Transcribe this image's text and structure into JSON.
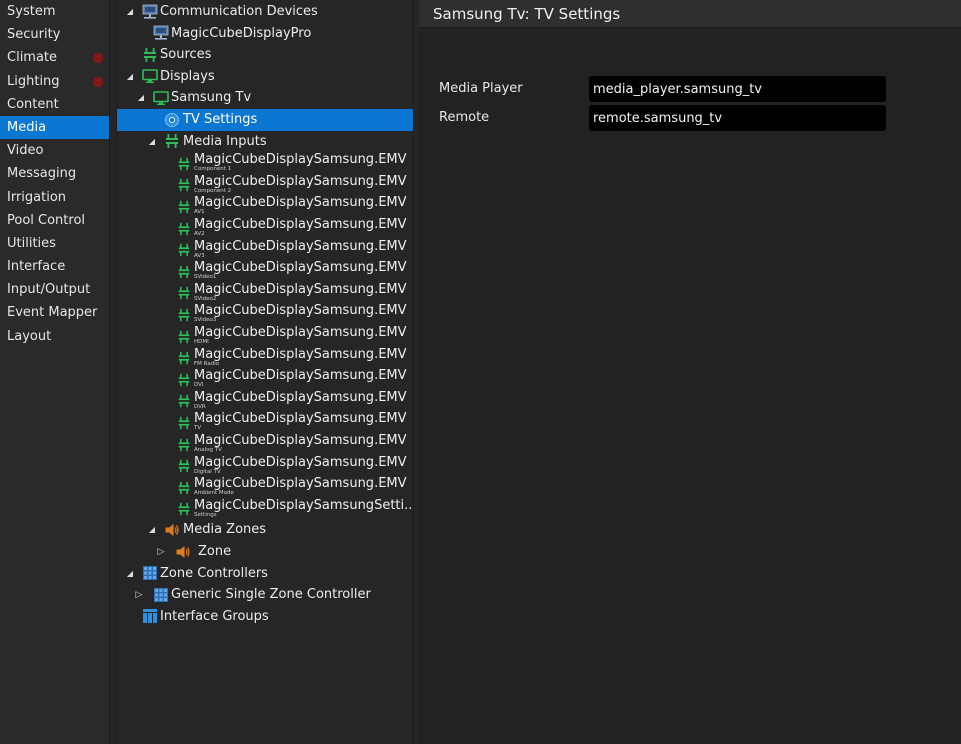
{
  "nav": {
    "items": [
      {
        "label": "System",
        "dot": false
      },
      {
        "label": "Security",
        "dot": false
      },
      {
        "label": "Climate",
        "dot": true
      },
      {
        "label": "Lighting",
        "dot": true
      },
      {
        "label": "Content",
        "dot": false
      },
      {
        "label": "Media",
        "dot": false,
        "selected": true
      },
      {
        "label": "Video",
        "dot": false
      },
      {
        "label": "Messaging",
        "dot": false
      },
      {
        "label": "Irrigation",
        "dot": false
      },
      {
        "label": "Pool Control",
        "dot": false
      },
      {
        "label": "Utilities",
        "dot": false
      },
      {
        "label": "Interface",
        "dot": false
      },
      {
        "label": "Input/Output",
        "dot": false
      },
      {
        "label": "Event Mapper",
        "dot": false
      },
      {
        "label": "Layout",
        "dot": false
      }
    ]
  },
  "tree": {
    "communication_devices": "Communication Devices",
    "magic_cube_display_pro": "MagicCubeDisplayPro",
    "sources": "Sources",
    "displays": "Displays",
    "samsung_tv": "Samsung Tv",
    "tv_settings": "TV Settings",
    "media_inputs": "Media Inputs",
    "inputs": [
      {
        "name": "MagicCubeDisplaySamsung.EMV",
        "sub": "Component 1"
      },
      {
        "name": "MagicCubeDisplaySamsung.EMV",
        "sub": "Component 2"
      },
      {
        "name": "MagicCubeDisplaySamsung.EMV",
        "sub": "AV1"
      },
      {
        "name": "MagicCubeDisplaySamsung.EMV",
        "sub": "AV2"
      },
      {
        "name": "MagicCubeDisplaySamsung.EMV",
        "sub": "AV3"
      },
      {
        "name": "MagicCubeDisplaySamsung.EMV",
        "sub": "SVideo1"
      },
      {
        "name": "MagicCubeDisplaySamsung.EMV",
        "sub": "SVideo2"
      },
      {
        "name": "MagicCubeDisplaySamsung.EMV",
        "sub": "SVideo3"
      },
      {
        "name": "MagicCubeDisplaySamsung.EMV",
        "sub": "HDMI"
      },
      {
        "name": "MagicCubeDisplaySamsung.EMV",
        "sub": "FM Radio"
      },
      {
        "name": "MagicCubeDisplaySamsung.EMV",
        "sub": "DVI"
      },
      {
        "name": "MagicCubeDisplaySamsung.EMV",
        "sub": "DVR"
      },
      {
        "name": "MagicCubeDisplaySamsung.EMV",
        "sub": "TV"
      },
      {
        "name": "MagicCubeDisplaySamsung.EMV",
        "sub": "Analog TV"
      },
      {
        "name": "MagicCubeDisplaySamsung.EMV",
        "sub": "Digital TV"
      },
      {
        "name": "MagicCubeDisplaySamsung.EMV",
        "sub": "Ambient Mode"
      },
      {
        "name": "MagicCubeDisplaySamsungSetti...",
        "sub": "Settings"
      }
    ],
    "media_zones": "Media Zones",
    "zone": "Zone",
    "zone_controllers": "Zone Controllers",
    "generic_zone_controller": "Generic Single Zone Controller",
    "interface_groups": "Interface Groups"
  },
  "panel": {
    "title": "Samsung Tv: TV Settings",
    "fields": [
      {
        "label": "Media Player",
        "value": "media_player.samsung_tv"
      },
      {
        "label": "Remote",
        "value": "remote.samsung_tv"
      }
    ]
  },
  "colors": {
    "selection": "#0b77d3",
    "icon_green": "#2ebd59",
    "icon_orange": "#e07a1f",
    "icon_blue": "#2f8fe0",
    "status_dot": "#8b1616"
  }
}
